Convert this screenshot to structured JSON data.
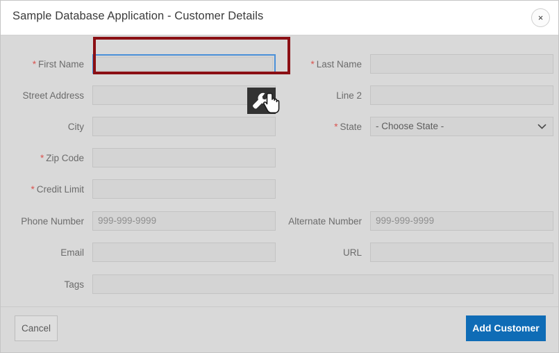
{
  "dialog": {
    "title": "Sample Database Application - Customer Details",
    "close_label": "×"
  },
  "form": {
    "rows": [
      {
        "left": {
          "label": "First Name",
          "required": true,
          "type": "text-focused",
          "value": "",
          "placeholder": ""
        },
        "right": {
          "label": "Last Name",
          "required": true,
          "type": "text",
          "value": "",
          "placeholder": ""
        }
      },
      {
        "left": {
          "label": "Street Address",
          "required": false,
          "type": "text",
          "value": "",
          "placeholder": ""
        },
        "right": {
          "label": "Line 2",
          "required": false,
          "type": "text",
          "value": "",
          "placeholder": ""
        }
      },
      {
        "left": {
          "label": "City",
          "required": false,
          "type": "text",
          "value": "",
          "placeholder": ""
        },
        "right": {
          "label": "State",
          "required": true,
          "type": "select",
          "value": "- Choose State -",
          "chevron": "⌄"
        }
      },
      {
        "left": {
          "label": "Zip Code",
          "required": true,
          "type": "text",
          "value": "",
          "placeholder": ""
        }
      },
      {
        "left": {
          "label": "Credit Limit",
          "required": true,
          "type": "text",
          "value": "",
          "placeholder": ""
        }
      },
      {
        "left": {
          "label": "Phone Number",
          "required": false,
          "type": "text",
          "value": "",
          "placeholder": "999-999-9999"
        },
        "right": {
          "label": "Alternate Number",
          "required": false,
          "type": "text",
          "value": "",
          "placeholder": "999-999-9999"
        }
      },
      {
        "left": {
          "label": "Email",
          "required": false,
          "type": "text",
          "value": "",
          "placeholder": ""
        },
        "right": {
          "label": "URL",
          "required": false,
          "type": "text",
          "value": "",
          "placeholder": ""
        }
      },
      {
        "full": {
          "label": "Tags",
          "required": false,
          "type": "text",
          "value": "",
          "placeholder": ""
        }
      }
    ],
    "required_marker": "*"
  },
  "footer": {
    "cancel_label": "Cancel",
    "submit_label": "Add Customer"
  },
  "annotation": {
    "highlight_color": "#8b0f14",
    "focus_color": "#4a90d9",
    "cursor_icon": "wrench-icon",
    "pointer_icon": "hand-pointer-icon"
  },
  "colors": {
    "accent": "#0f6cb6",
    "required_star": "#d9534f",
    "body_background": "#d9d9d9",
    "header_background": "#ffffff",
    "field_background": "#d4d4d4"
  }
}
